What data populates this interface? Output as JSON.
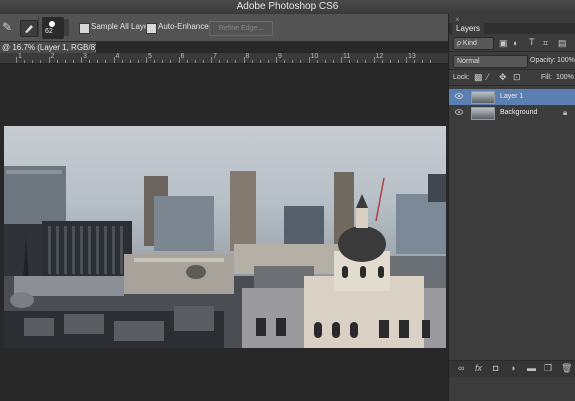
{
  "window": {
    "title": "Adobe Photoshop CS6"
  },
  "options": {
    "brush_size": "62",
    "sample_all_layers": "Sample All Layers",
    "auto_enhance": "Auto-Enhance",
    "refine_edge": "Refine Edge..."
  },
  "document": {
    "tab_label": "@ 16.7% (Layer 1, RGB/8) *"
  },
  "ruler": {
    "labels": [
      "1",
      "2",
      "3",
      "4",
      "5",
      "6",
      "7",
      "8",
      "9",
      "10",
      "11",
      "12",
      "13"
    ]
  },
  "panel": {
    "close": "×",
    "tab": "Layers",
    "kind_filter": "ρ Kind",
    "blend_mode": "Normal",
    "opacity_label": "Opacity:",
    "opacity_value": "100%",
    "lock_label": "Lock:",
    "fill_label": "Fill:",
    "fill_value": "100%",
    "layers": [
      {
        "name": "Layer 1",
        "selected": true
      },
      {
        "name": "Background",
        "selected": false
      }
    ]
  },
  "colors": {
    "selected_layer": "#5a7fb0",
    "canvas_bg": "#282828"
  }
}
